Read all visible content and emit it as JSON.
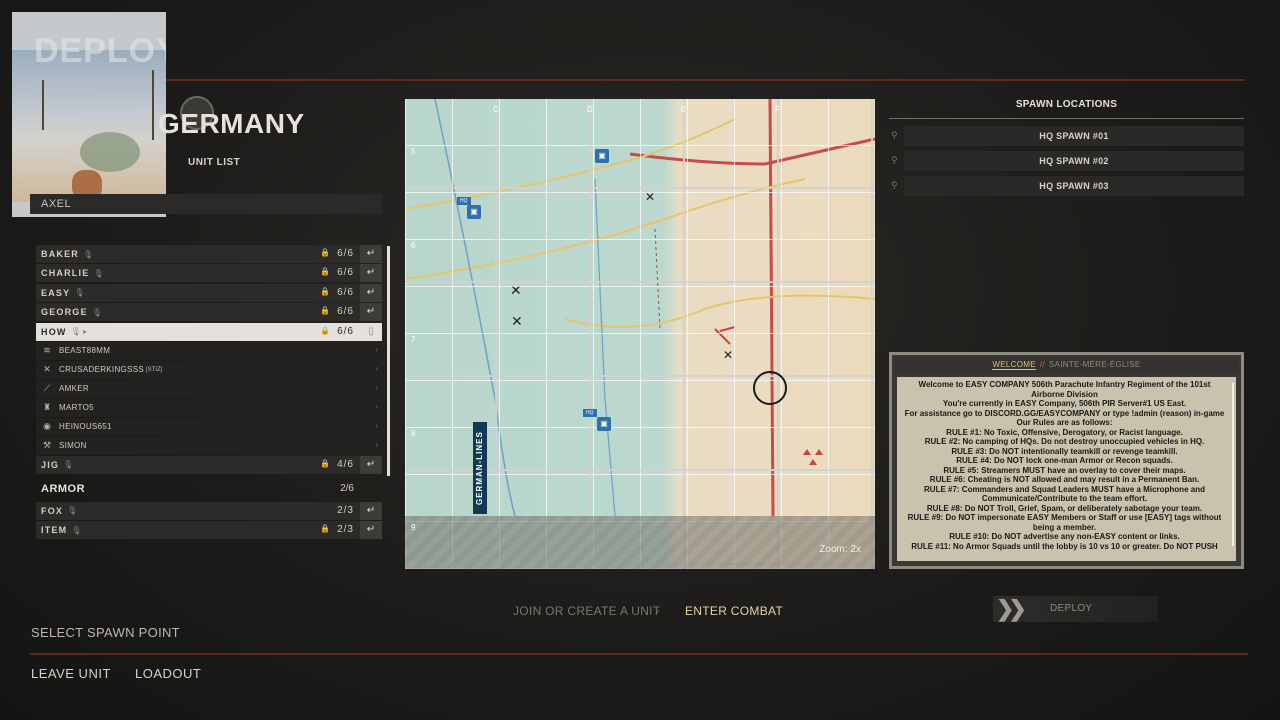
{
  "faction": {
    "title": "GERMANY",
    "unit_list_label": "UNIT LIST"
  },
  "commander": {
    "name": "AXEL"
  },
  "thumbnail": {
    "ghost_text": "DEPLOY"
  },
  "units": {
    "infantry": [
      {
        "name": "BAKER",
        "count": "6/6"
      },
      {
        "name": "CHARLIE",
        "count": "6/6"
      },
      {
        "name": "EASY",
        "count": "6/6"
      },
      {
        "name": "GEORGE",
        "count": "6/6"
      },
      {
        "name": "HOW",
        "count": "6/6",
        "selected": true
      }
    ],
    "members": [
      {
        "icon": "officer-icon",
        "name": "BEAST88MM",
        "tag": ""
      },
      {
        "icon": "crossed-rifles-icon",
        "name": "CRUSADERKINGSSS",
        "tag": "[STIZ]"
      },
      {
        "icon": "rifleman-icon",
        "name": "AMKER",
        "tag": ""
      },
      {
        "icon": "support-icon",
        "name": "MARTO5",
        "tag": ""
      },
      {
        "icon": "medic-icon",
        "name": "HEINOUS651",
        "tag": ""
      },
      {
        "icon": "engineer-icon",
        "name": "SIMON",
        "tag": ""
      }
    ],
    "jig": {
      "name": "JIG",
      "count": "4/6"
    },
    "armor_header": {
      "name": "ARMOR",
      "count": "2/6"
    },
    "armor": [
      {
        "name": "FOX",
        "count": "2/3"
      },
      {
        "name": "ITEM",
        "count": "2/3"
      }
    ]
  },
  "map": {
    "zoom": "Zoom: 2x",
    "german_lines": "GERMAN-LINES",
    "col_labels": [
      "C",
      "D",
      "E",
      "F"
    ],
    "row_labels": [
      "5",
      "6",
      "7",
      "8",
      "9"
    ]
  },
  "spawn": {
    "title": "SPAWN LOCATIONS",
    "items": [
      "HQ SPAWN #01",
      "HQ SPAWN #02",
      "HQ SPAWN #03"
    ]
  },
  "welcome": {
    "tab_active": "WELCOME",
    "tab_other": "SAINTE-MÈRE-ÉGLISE",
    "lines": [
      "Welcome to EASY COMPANY 506th Parachute Infantry Regiment of the 101st Airborne Division",
      "You're currently in EASY Company, 506th PIR Server#1 US East.",
      "For assistance go to DISCORD.GG/EASYCOMPANY or type !admin (reason) in-game",
      "Our Rules are as follows:",
      "RULE #1: No Toxic, Offensive, Derogatory, or Racist language.",
      "RULE #2: No camping of HQs. Do not destroy unoccupied vehicles in HQ.",
      "RULE #3: Do NOT intentionally teamkill or revenge teamkill.",
      "RULE #4: Do NOT lock one-man Armor or Recon squads.",
      "RULE #5: Streamers MUST have an overlay to cover their maps.",
      "RULE #6: Cheating is NOT allowed and may result in a Permanent Ban.",
      "RULE #7: Commanders and Squad Leaders MUST have a Microphone and Communicate/Contribute to the team effort.",
      "RULE #8: Do NOT Troll, Grief, Spam, or deliberately sabotage your team.",
      "RULE #9: Do NOT impersonate EASY Members or Staff or use [EASY] tags without being a member.",
      "RULE #10: Do NOT advertise any non-EASY content or links.",
      "RULE #11: No Armor Squads until the lobby is 10 vs 10 or greater. Do NOT PUSH"
    ]
  },
  "steps": {
    "join_create": "JOIN OR CREATE A UNIT",
    "enter_combat": "ENTER COMBAT",
    "deploy": "DEPLOY"
  },
  "footer": {
    "select_spawn": "SELECT SPAWN POINT",
    "leave_unit": "LEAVE UNIT",
    "loadout": "LOADOUT"
  },
  "colors": {
    "accent_red": "#5a2a20",
    "active_gold": "#e3d4a4",
    "selected_row": "#e4e1dc"
  }
}
